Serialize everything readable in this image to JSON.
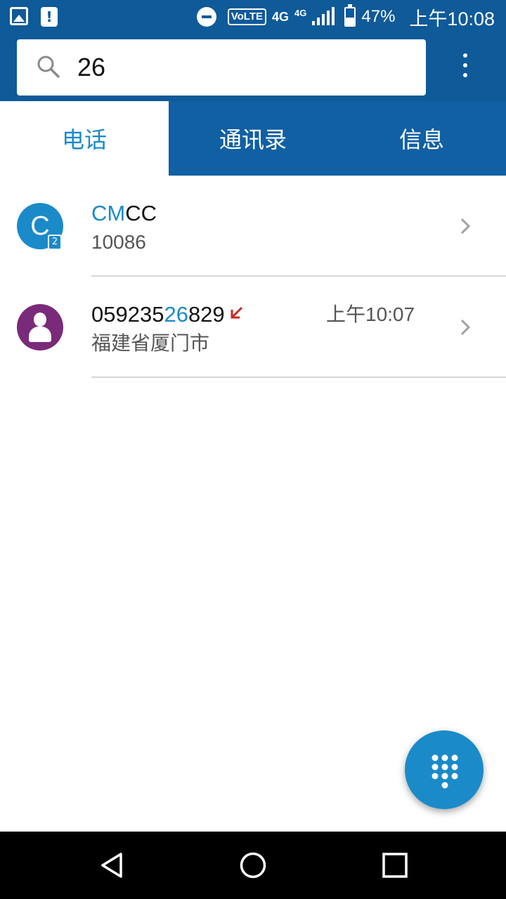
{
  "status_bar": {
    "battery_percent": "47%",
    "time": "上午10:08",
    "volte_label": "VoLTE",
    "network_primary": "4G",
    "network_secondary": "4G",
    "battery_level": 0.47,
    "icons": [
      "gallery-notification-icon",
      "alert-notification-icon",
      "do-not-disturb-icon",
      "volte-icon",
      "signal-icon",
      "battery-icon"
    ]
  },
  "search": {
    "query": "26"
  },
  "tabs": [
    {
      "label": "电话",
      "active": true
    },
    {
      "label": "通讯录",
      "active": false
    },
    {
      "label": "信息",
      "active": false
    }
  ],
  "results": [
    {
      "avatar_letter": "C",
      "sim_badge": "2",
      "name_highlight": "CM",
      "name_rest": "CC",
      "number": "10086"
    },
    {
      "number_prefix": "059235",
      "number_highlight": "26",
      "number_suffix": "829",
      "call_type": "missed",
      "time": "上午10:07",
      "location": "福建省厦门市"
    }
  ],
  "colors": {
    "header_blue": "#0f5a99",
    "accent_blue": "#1a8ac9",
    "contact_purple": "#7a2a7a",
    "missed_red": "#c62828"
  }
}
